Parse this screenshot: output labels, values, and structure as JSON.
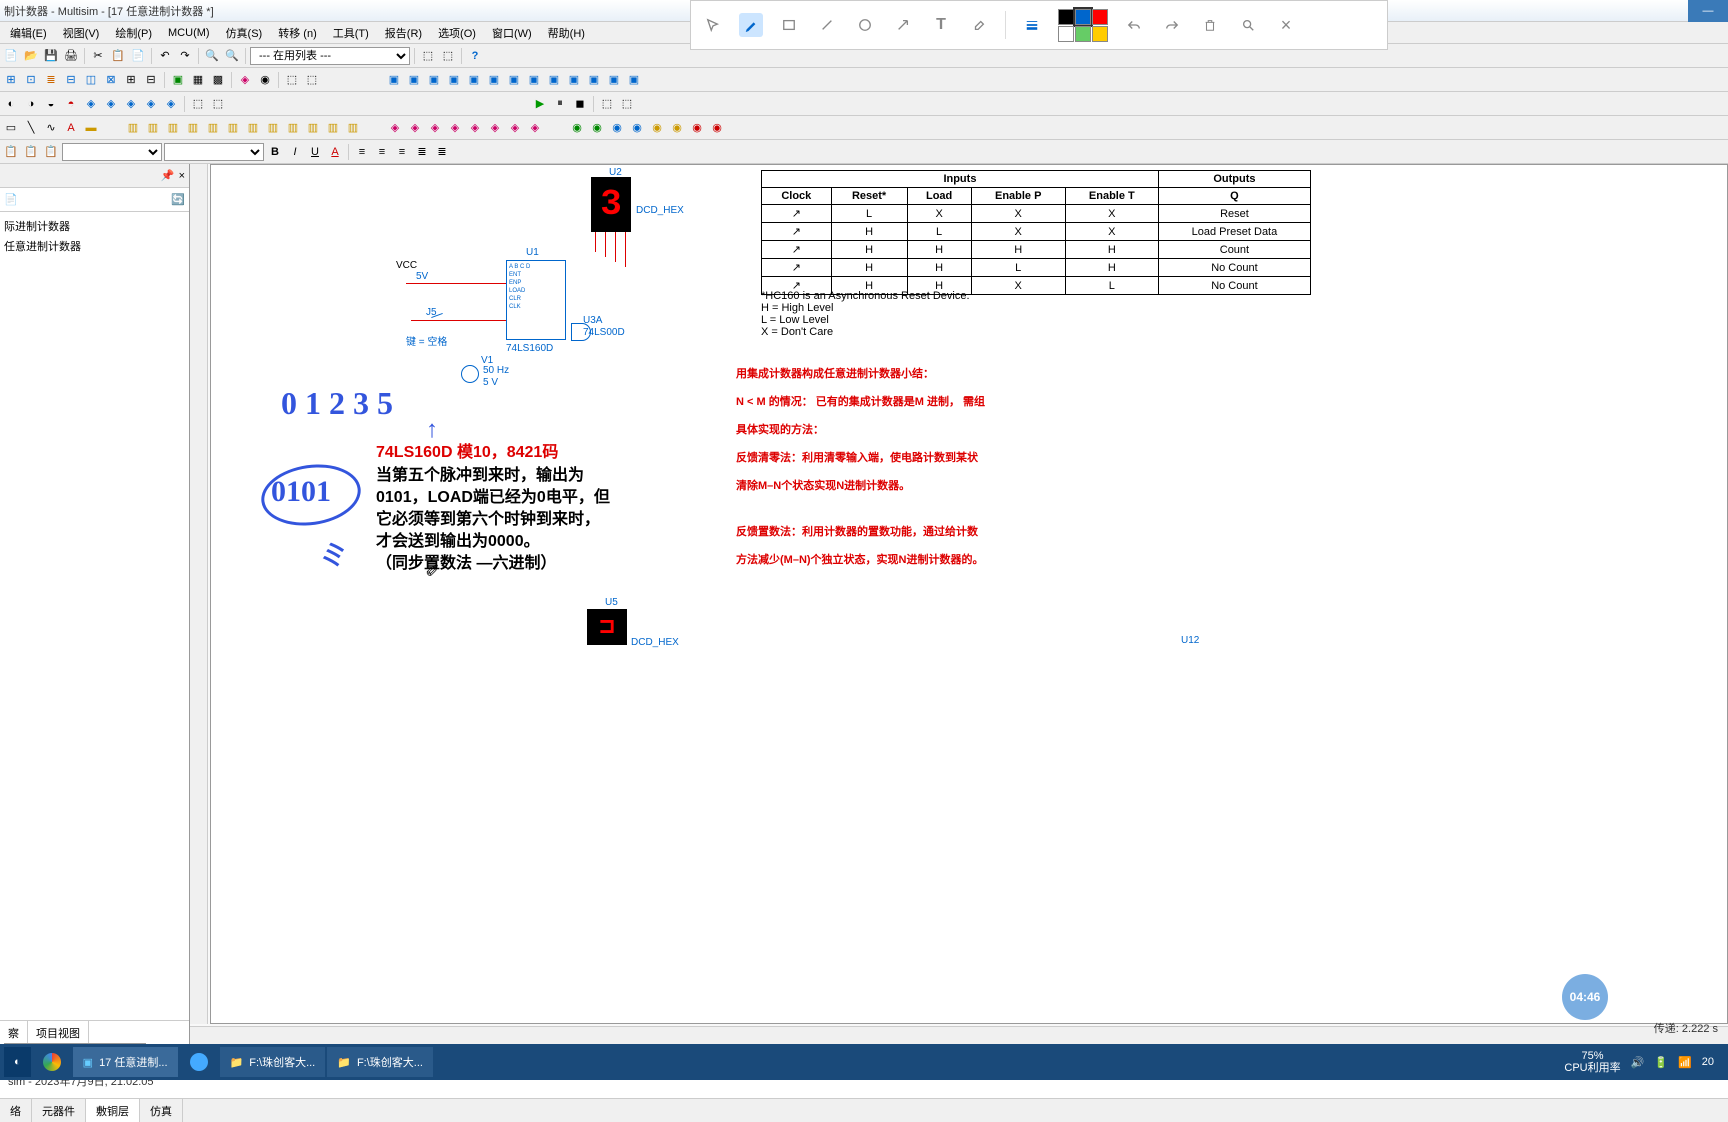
{
  "window": {
    "title": "制计数器 - Multisim - [17 任意进制计数器 *]"
  },
  "menus": [
    "编辑(E)",
    "视图(V)",
    "绘制(P)",
    "MCU(M)",
    "仿真(S)",
    "转移 (n)",
    "工具(T)",
    "报告(R)",
    "选项(O)",
    "窗口(W)",
    "帮助(H)"
  ],
  "toolbar_combo": "--- 在用列表 ---",
  "tree": {
    "items": [
      "际进制计数器",
      "任意进制计数器"
    ]
  },
  "side_tabs": [
    "察",
    "项目视图"
  ],
  "doc_tab": "17 任意进制计数器 *",
  "status": "sim  -  2023年7月9日, 21:02:05",
  "bottom_tabs": [
    "络",
    "元器件",
    "敷铜层",
    "仿真"
  ],
  "circuit": {
    "u2": "U2",
    "dcd_hex": "DCD_HEX",
    "u1": "U1",
    "vcc": "VCC",
    "v5": "5V",
    "j5": "J5",
    "key": "键 = 空格",
    "chip": "74LS160D",
    "u3a": "U3A",
    "gate": "74LS00D",
    "v1": "V1",
    "freq": "50 Hz",
    "amp": "5 V",
    "u5": "U5",
    "dcd_hex2": "DCD_HEX",
    "u12": "U12"
  },
  "handwriting": {
    "count": "0 1 2 3 5",
    "circled": "0101"
  },
  "annotations": {
    "title": "74LS160D  模10，8421码",
    "para1": "当第五个脉冲到来时，输出为",
    "para2": "0101，LOAD端已经为0电平，但",
    "para3": "它必须等到第六个时钟到来时，",
    "para4": "才会送到输出为0000。",
    "para5": "（同步置数法 —六进制）"
  },
  "summary": {
    "line1": "用集成计数器构成任意进制计数器小结：",
    "line2": "N < M 的情况： 已有的集成计数器是M 进制， 需组",
    "line3": "具体实现的方法：",
    "line4": "反馈清零法：利用清零输入端，使电路计数到某状",
    "line5": "清除M–N个状态实现N进制计数器。",
    "line6": "反馈置数法：利用计数器的置数功能，通过给计数",
    "line7": "方法减少(M–N)个独立状态，实现N进制计数器的。"
  },
  "table": {
    "headers_top": [
      "Inputs",
      "Outputs"
    ],
    "headers": [
      "Clock",
      "Reset*",
      "Load",
      "Enable P",
      "Enable T",
      "Q"
    ],
    "rows": [
      [
        "↗",
        "L",
        "X",
        "X",
        "X",
        "Reset"
      ],
      [
        "↗",
        "H",
        "L",
        "X",
        "X",
        "Load Preset Data"
      ],
      [
        "↗",
        "H",
        "H",
        "H",
        "H",
        "Count"
      ],
      [
        "↗",
        "H",
        "H",
        "L",
        "H",
        "No Count"
      ],
      [
        "↗",
        "H",
        "H",
        "X",
        "L",
        "No Count"
      ]
    ],
    "notes": [
      "*HC160 is an Asynchronous Reset Device.",
      "H = High Level",
      "L = Low Level",
      "X = Don't Care"
    ]
  },
  "taskbar": {
    "items": [
      "17 任意进制...",
      "",
      "F:\\珠创客大...",
      "F:\\珠创客大..."
    ]
  },
  "systray": {
    "cpu_pct": "75%",
    "cpu_label": "CPU利用率",
    "time": "20"
  },
  "video_time": "04:46",
  "transfer": "传递: 2.222 s",
  "seg_digit": "3",
  "seg_digit2": "⊐"
}
